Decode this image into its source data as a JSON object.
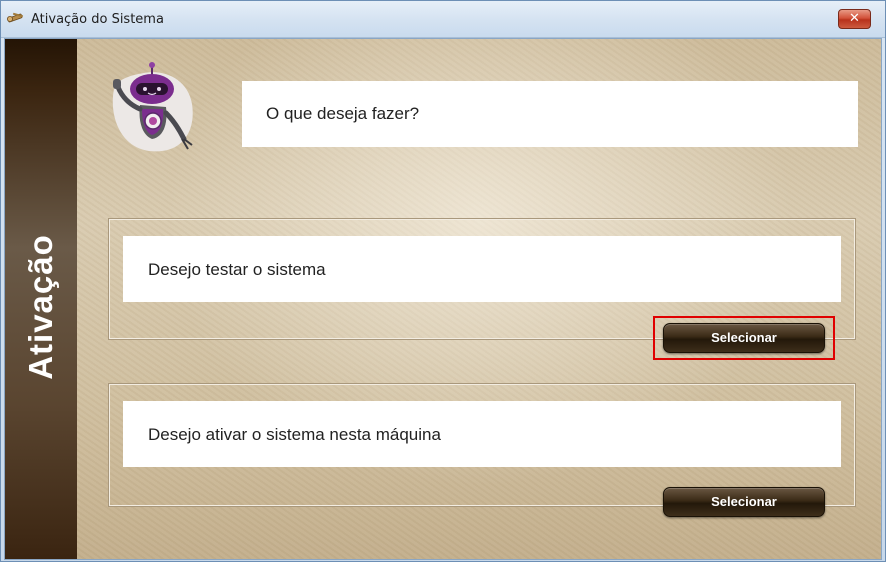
{
  "window": {
    "title": "Ativação do Sistema",
    "close_label": "✕"
  },
  "sidebar": {
    "label": "Ativação"
  },
  "header": {
    "question": "O que deseja fazer?"
  },
  "options": [
    {
      "text": "Desejo testar o sistema",
      "button_label": "Selecionar",
      "focused": true
    },
    {
      "text": "Desejo ativar o sistema nesta máquina",
      "button_label": "Selecionar",
      "focused": false
    }
  ],
  "colors": {
    "sidebar_dark": "#3b2510",
    "button_brown": "#3a2a16",
    "focus_red": "#e00000",
    "robot_purple": "#7b2d8e"
  },
  "icons": {
    "title": "keys-icon",
    "mascot": "robot-mascot-icon"
  }
}
